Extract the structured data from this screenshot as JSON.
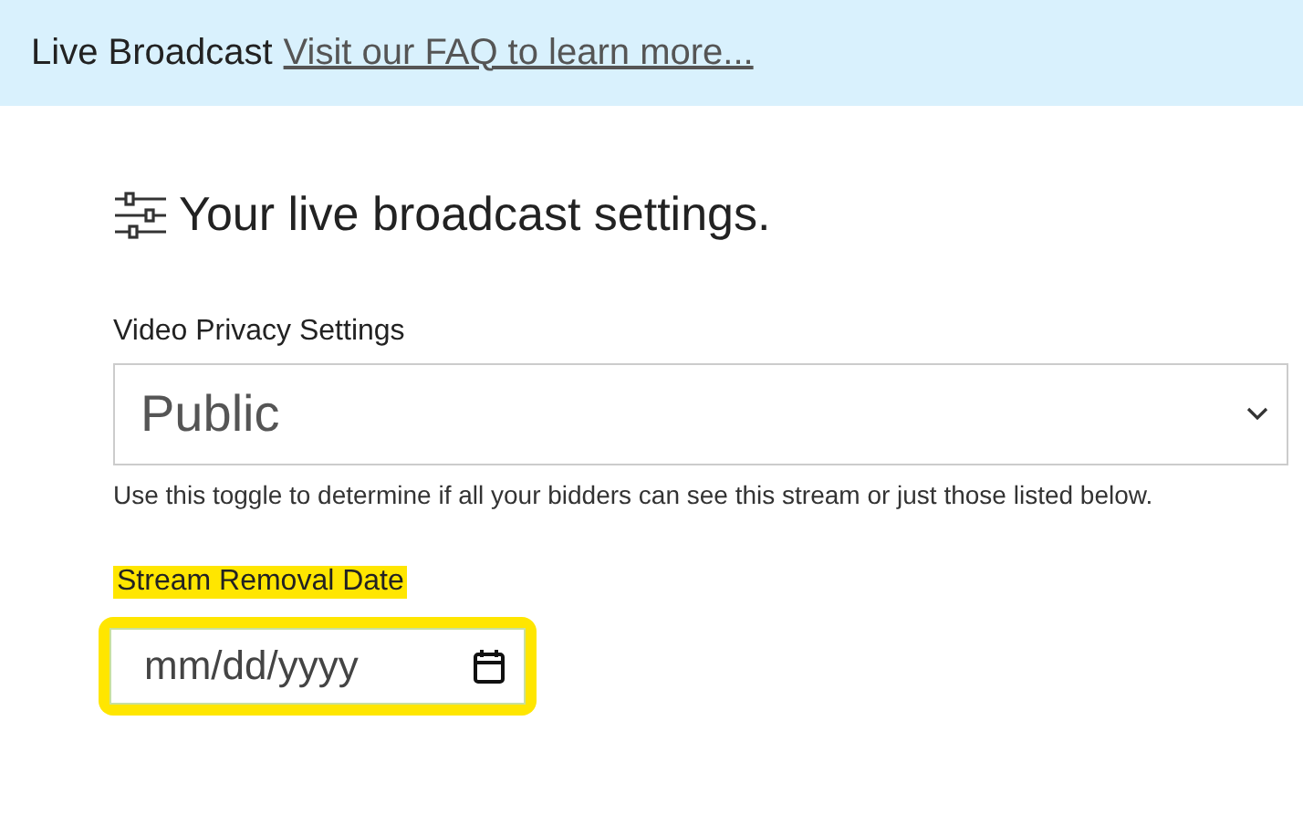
{
  "banner": {
    "title": "Live Broadcast",
    "link": "Visit our FAQ to learn more..."
  },
  "heading": "Your live broadcast settings.",
  "privacy": {
    "label": "Video Privacy Settings",
    "value": "Public",
    "help": "Use this toggle to determine if all your bidders can see this stream or just those listed below."
  },
  "removal_date": {
    "label": "Stream Removal Date",
    "placeholder": "mm/dd/yyyy",
    "highlighted": true
  }
}
